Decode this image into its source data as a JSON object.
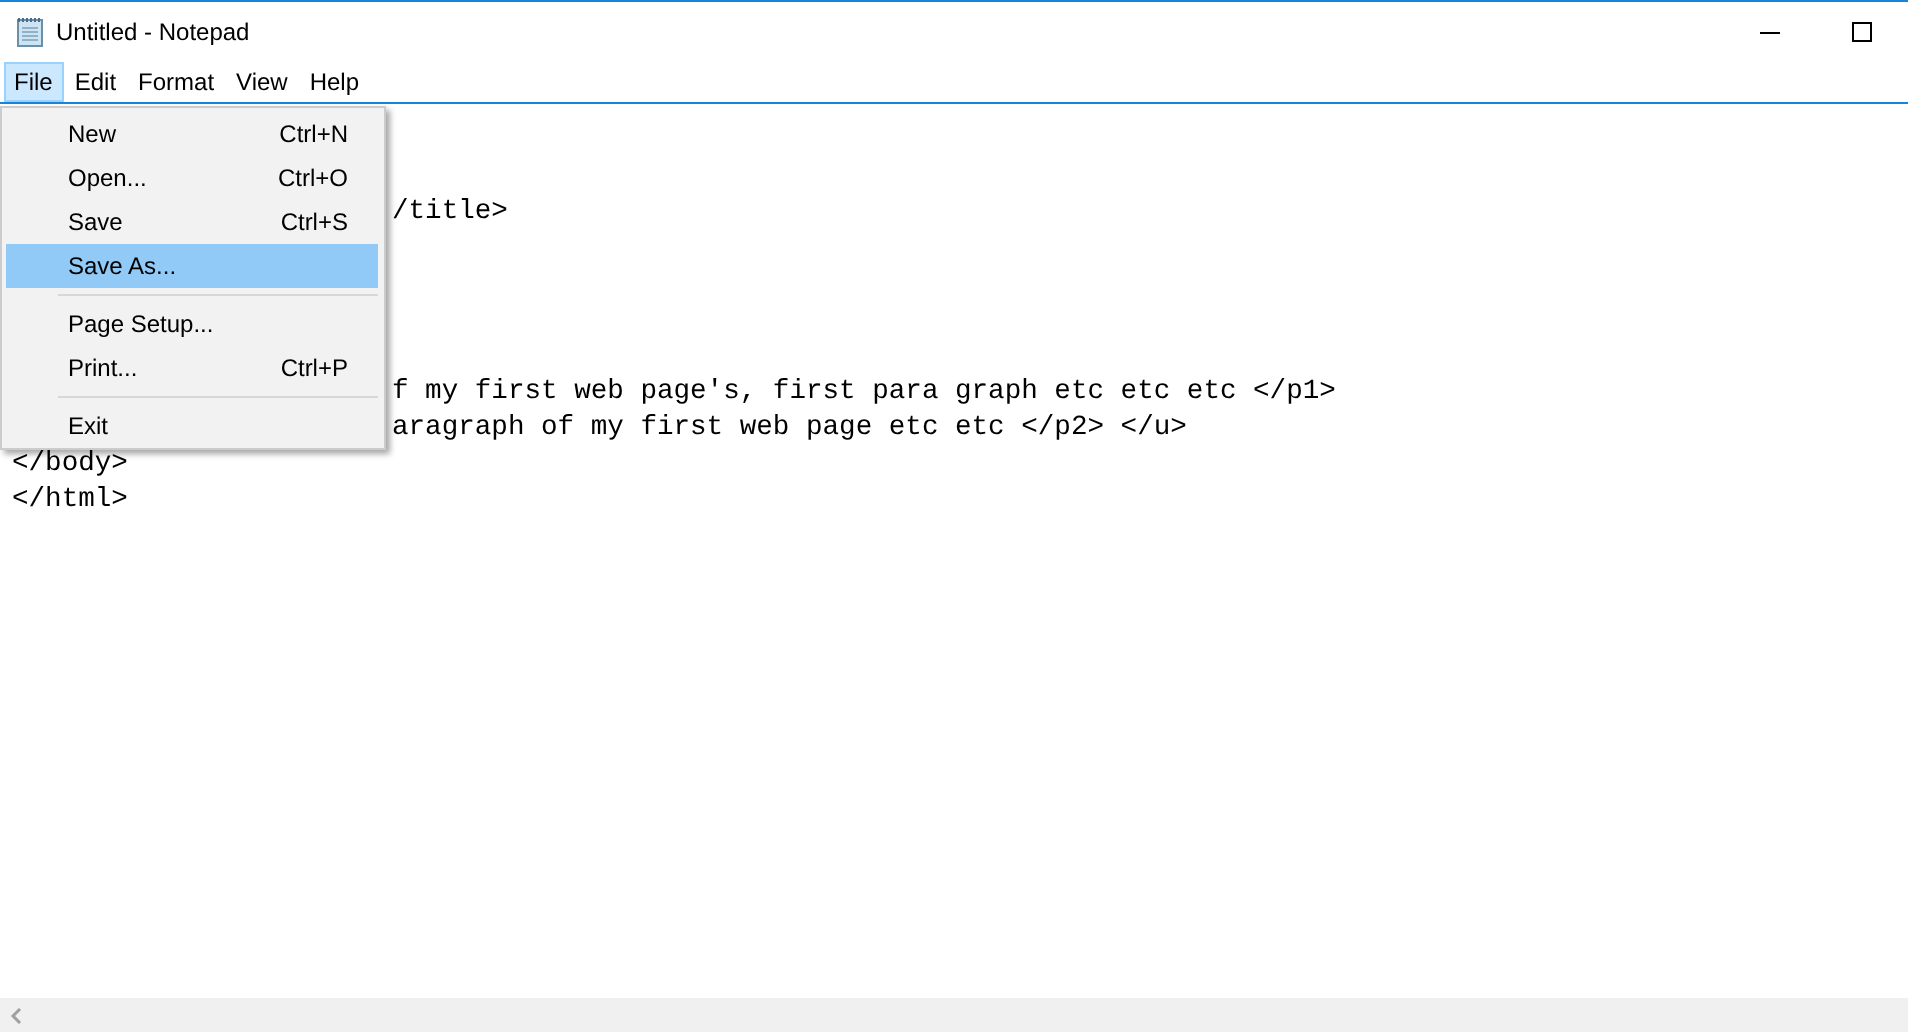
{
  "window": {
    "title": "Untitled - Notepad"
  },
  "menu_bar": [
    {
      "label": "File",
      "selected": true
    },
    {
      "label": "Edit",
      "selected": false
    },
    {
      "label": "Format",
      "selected": false
    },
    {
      "label": "View",
      "selected": false
    },
    {
      "label": "Help",
      "selected": false
    }
  ],
  "file_menu": [
    {
      "kind": "item",
      "label": "New",
      "shortcut": "Ctrl+N",
      "selected": false
    },
    {
      "kind": "item",
      "label": "Open...",
      "shortcut": "Ctrl+O",
      "selected": false
    },
    {
      "kind": "item",
      "label": "Save",
      "shortcut": "Ctrl+S",
      "selected": false
    },
    {
      "kind": "item",
      "label": "Save As...",
      "selected": true
    },
    {
      "kind": "separator"
    },
    {
      "kind": "item",
      "label": "Page Setup...",
      "selected": false
    },
    {
      "kind": "item",
      "label": "Print...",
      "shortcut": "Ctrl+P",
      "selected": false
    },
    {
      "kind": "separator"
    },
    {
      "kind": "item",
      "label": "Exit",
      "selected": false
    }
  ],
  "editor": {
    "lines": [
      {
        "kind": "hidden"
      },
      {
        "kind": "hidden"
      },
      {
        "kind": "after_menu",
        "text": "/title>"
      },
      {
        "kind": "hidden"
      },
      {
        "kind": "hidden"
      },
      {
        "kind": "hidden"
      },
      {
        "kind": "hidden"
      },
      {
        "kind": "after_menu",
        "text": "f my first web page's, first para graph etc etc etc </p1>"
      },
      {
        "kind": "after_menu",
        "text": "aragraph of my first web page etc etc </p2> </u>"
      },
      {
        "kind": "full",
        "text": "</body>"
      },
      {
        "kind": "full",
        "text": "</html>"
      }
    ]
  }
}
